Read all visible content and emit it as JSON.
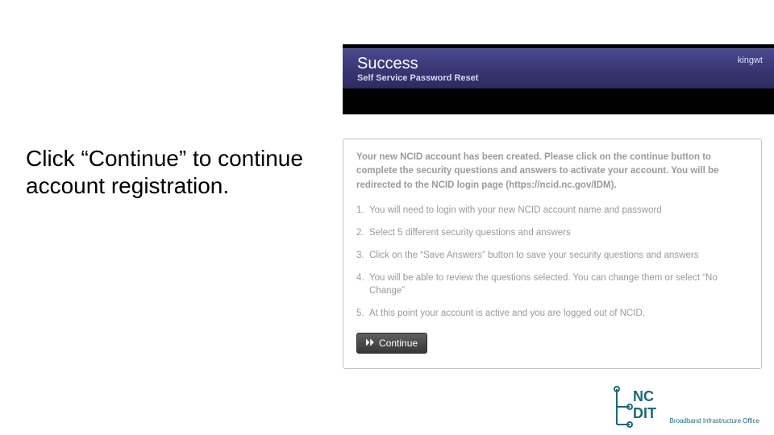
{
  "header": {
    "title": "Success",
    "subtitle": "Self Service Password Reset",
    "user": "kingwt"
  },
  "instruction_text": "Click “Continue” to continue account registration.",
  "panel": {
    "intro": "Your new NCID account has been created. Please click on the continue button to complete the security questions and answers to activate your account. You will be redirected to the NCID login page (https://ncid.nc.gov/IDM).",
    "steps": [
      "You will need to login with your new NCID account name and password",
      "Select 5 different security questions and answers",
      "Click on the “Save Answers” button to save your security questions and answers",
      "You will be able to review the questions selected. You can change them or select “No Change”",
      "At this point your account is active and you are logged out of NCID."
    ],
    "continue_label": "Continue"
  },
  "logo": {
    "line1": "NC",
    "line2": "DIT",
    "tagline": "Broadband Infrastructure Office"
  }
}
